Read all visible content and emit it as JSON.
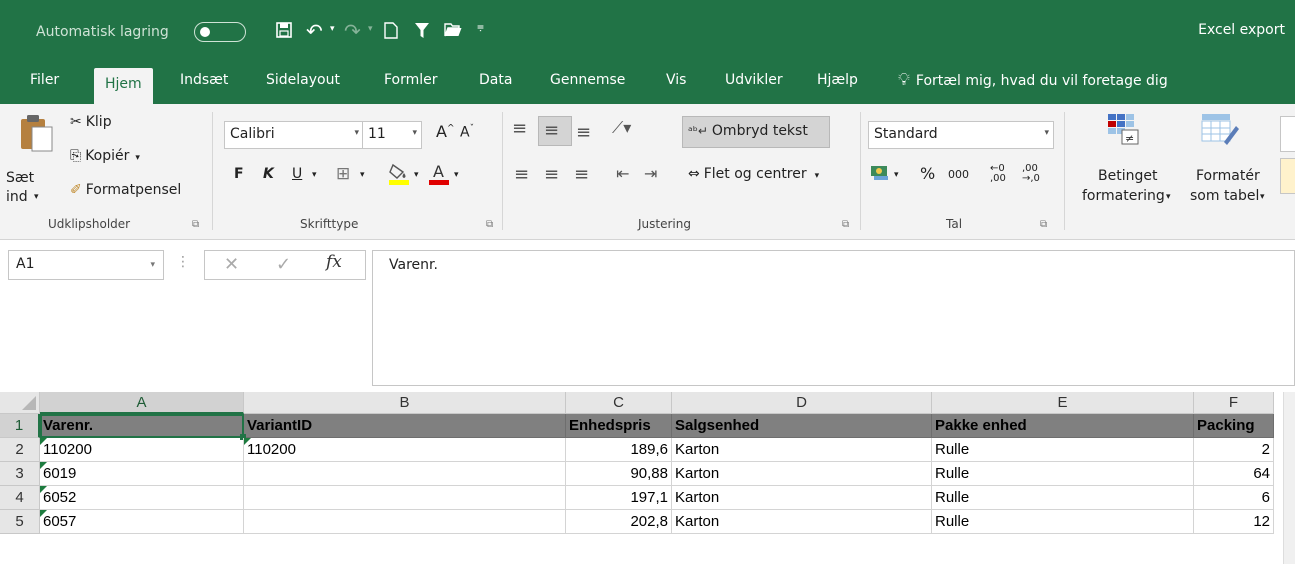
{
  "titlebar": {
    "autosave_label": "Automatisk lagring",
    "doc_title": "Excel export"
  },
  "menu": {
    "tabs": [
      "Filer",
      "Hjem",
      "Indsæt",
      "Sidelayout",
      "Formler",
      "Data",
      "Gennemse",
      "Vis",
      "Udvikler",
      "Hjælp"
    ],
    "active": "Hjem",
    "tell_me": "Fortæl mig, hvad du vil foretage dig"
  },
  "ribbon": {
    "clipboard": {
      "paste_line1": "Sæt",
      "paste_line2": "ind",
      "cut": "Klip",
      "copy": "Kopiér",
      "format_painter": "Formatpensel",
      "label": "Udklipsholder"
    },
    "font": {
      "name": "Calibri",
      "size": "11",
      "bold": "F",
      "italic": "K",
      "underline": "U",
      "label": "Skrifttype",
      "highlight_color": "#ffff00",
      "font_color": "#e00000"
    },
    "alignment": {
      "wrap_text": "Ombryd tekst",
      "merge_center": "Flet og centrer",
      "label": "Justering"
    },
    "number": {
      "format": "Standard",
      "percent": "%",
      "thousands": "000",
      "label": "Tal"
    },
    "styles": {
      "conditional_line1": "Betinget",
      "conditional_line2": "formatering",
      "format_table_line1": "Formatér",
      "format_table_line2": "som tabel"
    }
  },
  "formula_bar": {
    "name_box": "A1",
    "fx": "fx",
    "content": "Varenr."
  },
  "grid": {
    "columns": [
      "A",
      "B",
      "C",
      "D",
      "E",
      "F"
    ],
    "rows": [
      "1",
      "2",
      "3",
      "4",
      "5"
    ],
    "header_row": [
      "Varenr.",
      "VariantID",
      "Enhedspris",
      "Salgsenhed",
      "Pakke enhed",
      "Packing"
    ],
    "data": [
      [
        "110200",
        "110200",
        "189,6",
        "Karton",
        "Rulle",
        "2"
      ],
      [
        "6019",
        "",
        "90,88",
        "Karton",
        "Rulle",
        "64"
      ],
      [
        "6052",
        "",
        "197,1",
        "Karton",
        "Rulle",
        "6"
      ],
      [
        "6057",
        "",
        "202,8",
        "Karton",
        "Rulle",
        "12"
      ]
    ]
  },
  "colors": {
    "accent": "#217346"
  }
}
